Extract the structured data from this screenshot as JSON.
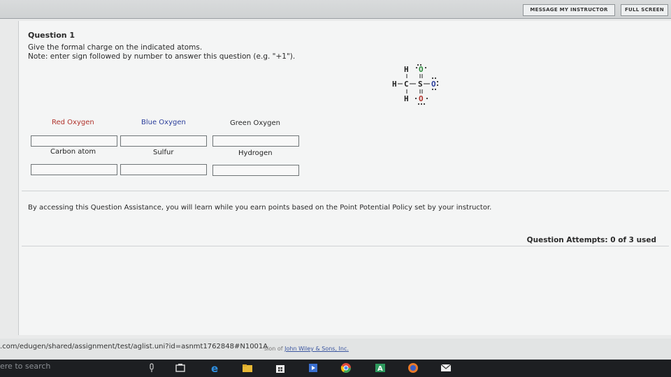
{
  "topbar": {
    "message_button": "MESSAGE MY INSTRUCTOR",
    "fullscreen_button": "FULL SCREEN"
  },
  "question": {
    "title": "Question 1",
    "line1": "Give the formal charge on the indicated atoms.",
    "line2": "Note: enter sign followed by number to answer this question (e.g. \"+1\")."
  },
  "fields_row1": [
    {
      "label": "Red Oxygen",
      "color": "#b0332c"
    },
    {
      "label": "Blue Oxygen",
      "color": "#2c3f9c"
    },
    {
      "label": "Green Oxygen",
      "color": "#2a2a2a"
    }
  ],
  "fields_row2": [
    {
      "label": "Carbon atom"
    },
    {
      "label": "Sulfur"
    },
    {
      "label": "Hydrogen"
    }
  ],
  "assistance_text": "By accessing this Question Assistance, you will learn while you earn points based on the Point Potential Policy set by your instructor.",
  "attempts_text": "Question Attempts: 0 of 3 used",
  "status": {
    "url": ".com/edugen/shared/assignment/test/aglist.uni?id=asnmt1762848#N1001A",
    "copyright_prefix": "sion of",
    "copyright_link": "John Wiley & Sons, Inc."
  },
  "taskbar": {
    "search_text": "ere to search"
  }
}
